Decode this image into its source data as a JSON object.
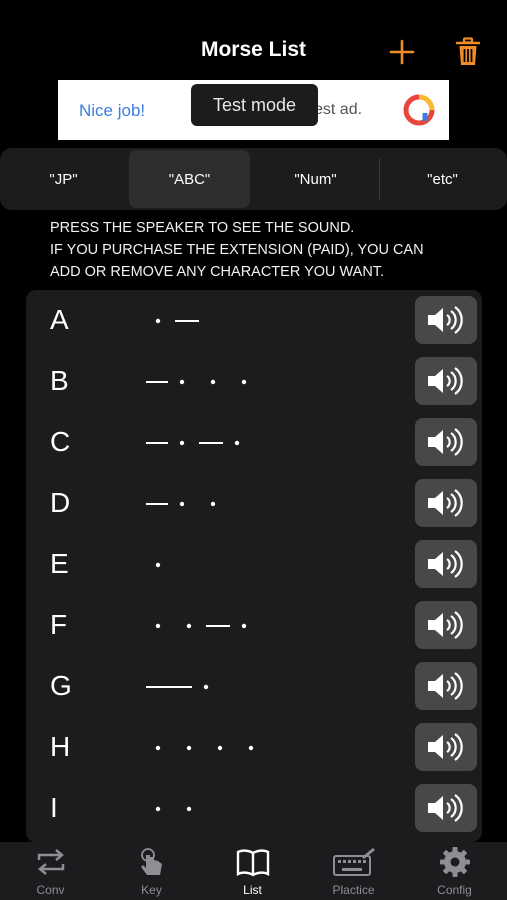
{
  "header": {
    "title": "Morse List",
    "add_icon": "plus-icon",
    "delete_icon": "trash-icon",
    "accent": "#f28c28"
  },
  "ad": {
    "left_text": "Nice job!",
    "right_text": "est ad.",
    "badge": "Test mode"
  },
  "segments": [
    {
      "label": "\"JP\"",
      "active": false
    },
    {
      "label": "\"ABC\"",
      "active": true
    },
    {
      "label": "\"Num\"",
      "active": false
    },
    {
      "label": "\"etc\"",
      "active": false
    }
  ],
  "instructions": [
    "PRESS THE SPEAKER TO SEE THE SOUND.",
    "IF YOU PURCHASE THE EXTENSION (PAID), YOU CAN",
    "ADD OR REMOVE ANY CHARACTER YOU WANT."
  ],
  "morse": [
    {
      "letter": "A",
      "code": ".-"
    },
    {
      "letter": "B",
      "code": "-..."
    },
    {
      "letter": "C",
      "code": "-.-."
    },
    {
      "letter": "D",
      "code": "-.."
    },
    {
      "letter": "E",
      "code": "."
    },
    {
      "letter": "F",
      "code": "..-."
    },
    {
      "letter": "G",
      "code": "--."
    },
    {
      "letter": "H",
      "code": "...."
    },
    {
      "letter": "I",
      "code": ".."
    }
  ],
  "tabs": [
    {
      "label": "Conv",
      "icon": "convert-icon",
      "active": false
    },
    {
      "label": "Key",
      "icon": "tap-icon",
      "active": false
    },
    {
      "label": "List",
      "icon": "book-icon",
      "active": true
    },
    {
      "label": "Plactice",
      "icon": "keyboard-pencil-icon",
      "active": false
    },
    {
      "label": "Config",
      "icon": "gear-icon",
      "active": false
    }
  ]
}
